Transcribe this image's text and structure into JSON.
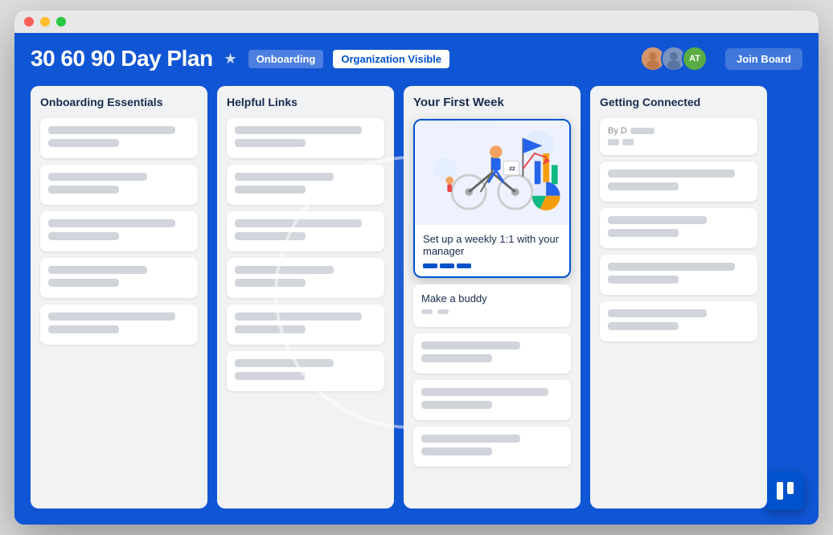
{
  "window": {
    "title": "30 60 90 Day Plan"
  },
  "header": {
    "board_title": "30 60 90 Day Plan",
    "star_icon": "★",
    "tag_onboarding": "Onboarding",
    "tag_org_visible": "Organization Visible",
    "join_board_label": "Join Board",
    "avatar_initials": "AT",
    "avatar_initials_bg": "#5aac44"
  },
  "columns": [
    {
      "id": "col1",
      "title": "Onboarding Essentials",
      "cards": [
        {
          "lines": [
            "long",
            "short"
          ]
        },
        {
          "lines": [
            "medium",
            "short"
          ]
        },
        {
          "lines": [
            "long",
            "short"
          ]
        },
        {
          "lines": [
            "medium",
            "short"
          ]
        },
        {
          "lines": [
            "long",
            "short"
          ]
        }
      ]
    },
    {
      "id": "col2",
      "title": "Helpful Links",
      "cards": [
        {
          "lines": [
            "long",
            "short"
          ]
        },
        {
          "lines": [
            "medium",
            "short"
          ]
        },
        {
          "lines": [
            "long",
            "short"
          ]
        },
        {
          "lines": [
            "medium",
            "short"
          ]
        },
        {
          "lines": [
            "long",
            "short"
          ]
        },
        {
          "lines": [
            "medium",
            "short"
          ]
        }
      ]
    },
    {
      "id": "col3",
      "title": "Your First Week",
      "featured_card": {
        "text": "Set up a weekly 1:1 with your manager"
      },
      "make_buddy_card": {
        "text": "Make a buddy"
      },
      "cards": [
        {
          "lines": [
            "medium",
            "short"
          ]
        },
        {
          "lines": [
            "long",
            "short"
          ]
        },
        {
          "lines": [
            "medium",
            "short"
          ]
        }
      ]
    },
    {
      "id": "col4",
      "title": "Getting Connected",
      "by_label": "By D",
      "cards": [
        {
          "lines": [
            "long",
            "short"
          ]
        },
        {
          "lines": [
            "medium",
            "short"
          ]
        },
        {
          "lines": [
            "long",
            "short"
          ]
        },
        {
          "lines": [
            "medium",
            "short"
          ]
        }
      ]
    }
  ],
  "trello_logo": {
    "label": "Trello"
  }
}
